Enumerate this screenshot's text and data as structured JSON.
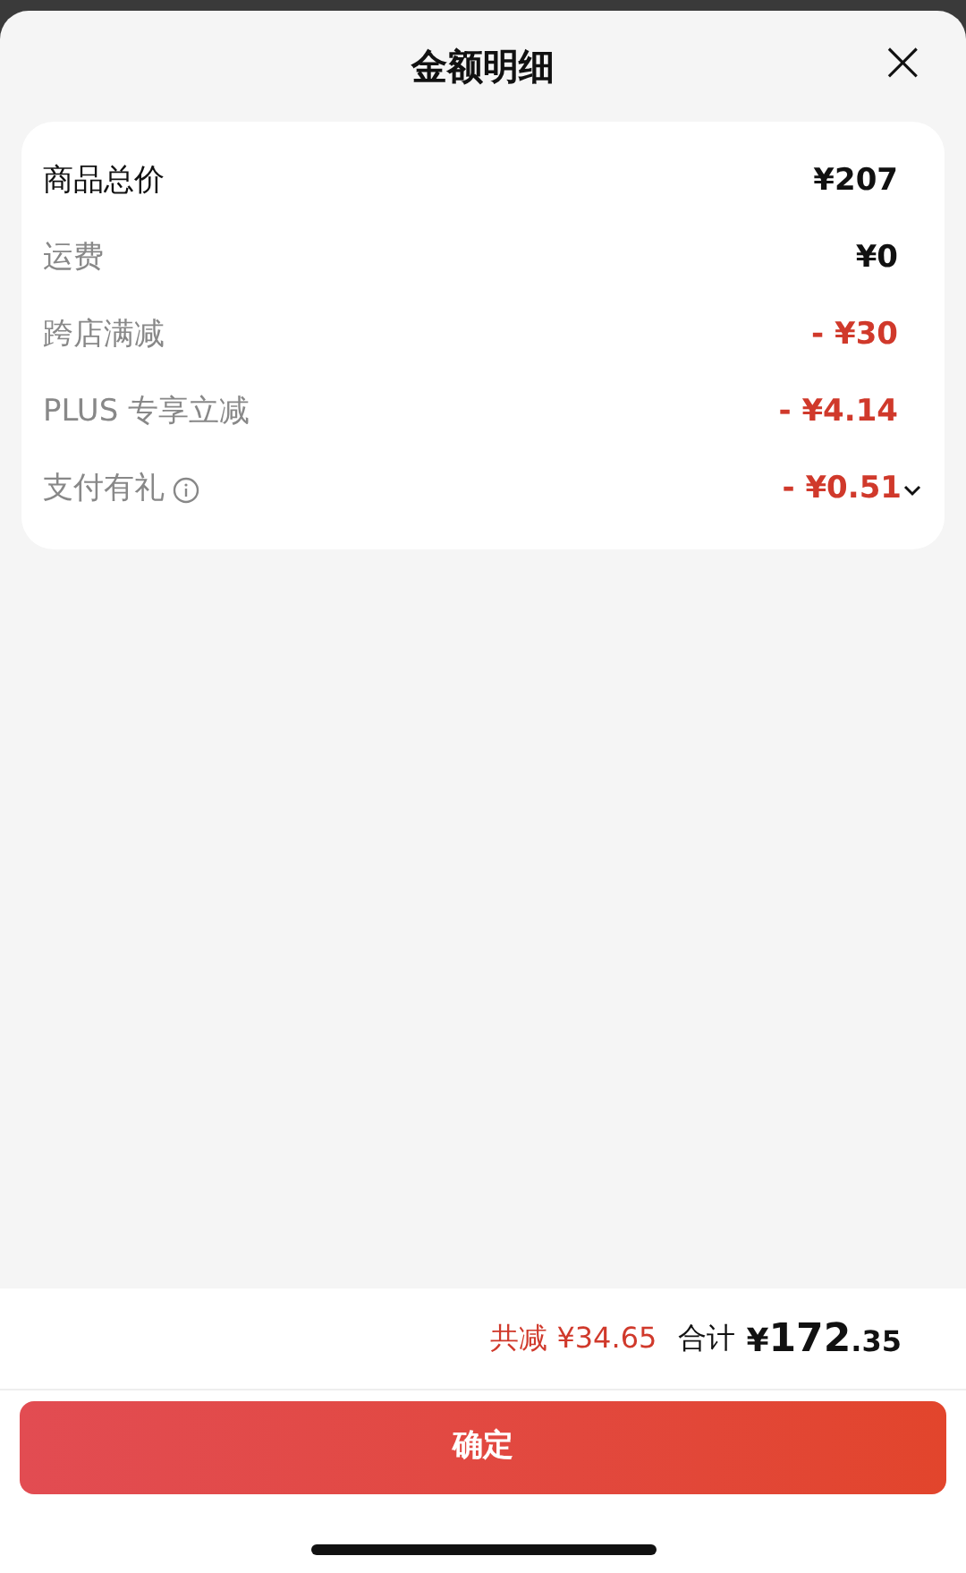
{
  "sheet": {
    "title": "金额明细",
    "close": "×"
  },
  "rows": [
    {
      "kind": "total",
      "label": "商品总价",
      "amount": "¥207"
    },
    {
      "kind": "normal",
      "label": "运费",
      "amount": "¥0"
    },
    {
      "kind": "discount",
      "label": "跨店满减",
      "amount": "- ¥30"
    },
    {
      "kind": "discount",
      "label": "PLUS 专享立减",
      "amount": "- ¥4.14"
    },
    {
      "kind": "discount",
      "label": "支付有礼",
      "amount": "- ¥0.51",
      "info": true,
      "expandable": true
    }
  ],
  "summary": {
    "discount": "共减 ¥34.65",
    "total_label": "合计",
    "currency": "¥",
    "integer": "172",
    "decimal": ".35"
  },
  "button": "确定"
}
